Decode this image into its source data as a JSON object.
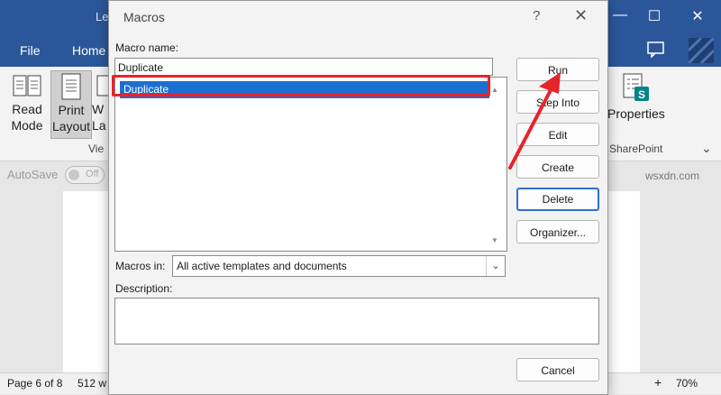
{
  "word": {
    "title_partial": "Le",
    "menu": [
      "File",
      "Home"
    ],
    "ribbon_buttons": [
      {
        "label": "Read\nMode"
      },
      {
        "label": "Print\nLayout"
      },
      {
        "label": "W\nLa"
      }
    ],
    "view_group_partial": "View",
    "properties_label": "Properties",
    "sharepoint_label": "SharePoint",
    "autosave_label": "AutoSave",
    "autosave_state": "Off",
    "status_page": "Page 6 of 8",
    "status_words": "512 w",
    "zoom": "70%",
    "watermark": "wsxdn.com"
  },
  "dialog": {
    "title": "Macros",
    "help_icon": "?",
    "close_icon": "✕",
    "macro_name_label": "Macro name:",
    "macro_name_value": "Duplicate",
    "macro_list": [
      "Duplicate"
    ],
    "selected_macro": "Duplicate",
    "buttons": {
      "run": "Run",
      "step_into": "Step Into",
      "edit": "Edit",
      "create": "Create",
      "delete": "Delete",
      "organizer": "Organizer..."
    },
    "macros_in_label": "Macros in:",
    "macros_in_value": "All active templates and documents",
    "description_label": "Description:",
    "cancel": "Cancel"
  },
  "colors": {
    "word_blue": "#2b579a",
    "selection_blue": "#1c6fd0",
    "highlight_red": "#e8232a",
    "sharepoint_teal": "#038387"
  }
}
